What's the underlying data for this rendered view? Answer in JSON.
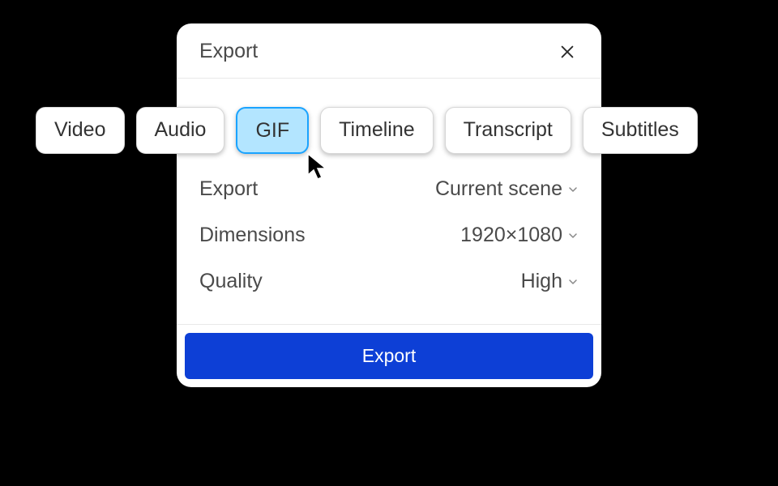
{
  "dialog": {
    "title": "Export",
    "tabs": [
      {
        "label": "Video",
        "selected": false
      },
      {
        "label": "Audio",
        "selected": false
      },
      {
        "label": "GIF",
        "selected": true
      },
      {
        "label": "Timeline",
        "selected": false
      },
      {
        "label": "Transcript",
        "selected": false
      },
      {
        "label": "Subtitles",
        "selected": false
      }
    ],
    "fields": {
      "export": {
        "label": "Export",
        "value": "Current scene"
      },
      "dimensions": {
        "label": "Dimensions",
        "value": "1920×1080"
      },
      "quality": {
        "label": "Quality",
        "value": "High"
      }
    },
    "action_button": "Export"
  }
}
